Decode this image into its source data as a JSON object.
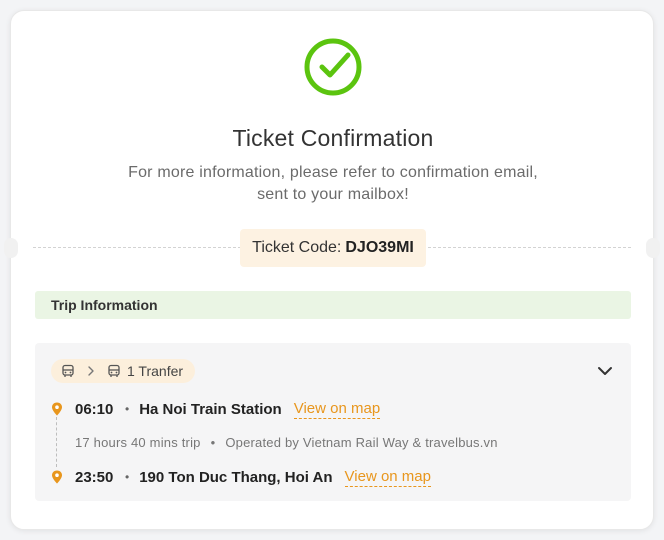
{
  "header": {
    "title": "Ticket Confirmation",
    "subtitle_line1": "For more information, please refer to confirmation email,",
    "subtitle_line2": "sent to your mailbox!",
    "icon": "check-circle-icon"
  },
  "ticket": {
    "label": "Ticket Code:",
    "code": "DJO39MI"
  },
  "trip": {
    "section_title": "Trip Information",
    "transfer_label": "1 Tranfer",
    "departure": {
      "time": "06:10",
      "place": "Ha Noi Train Station",
      "map_link": "View on map"
    },
    "duration": "17 hours 40 mins trip",
    "operator": "Operated by Vietnam Rail Way & travelbus.vn",
    "arrival": {
      "time": "23:50",
      "place": "190 Ton Duc Thang, Hoi An",
      "map_link": "View on map"
    }
  },
  "colors": {
    "success": "#5bc40f",
    "accent": "#e8961d",
    "trip_header_bg": "#eaf5e4",
    "ticket_code_bg": "#fdf2e2"
  }
}
